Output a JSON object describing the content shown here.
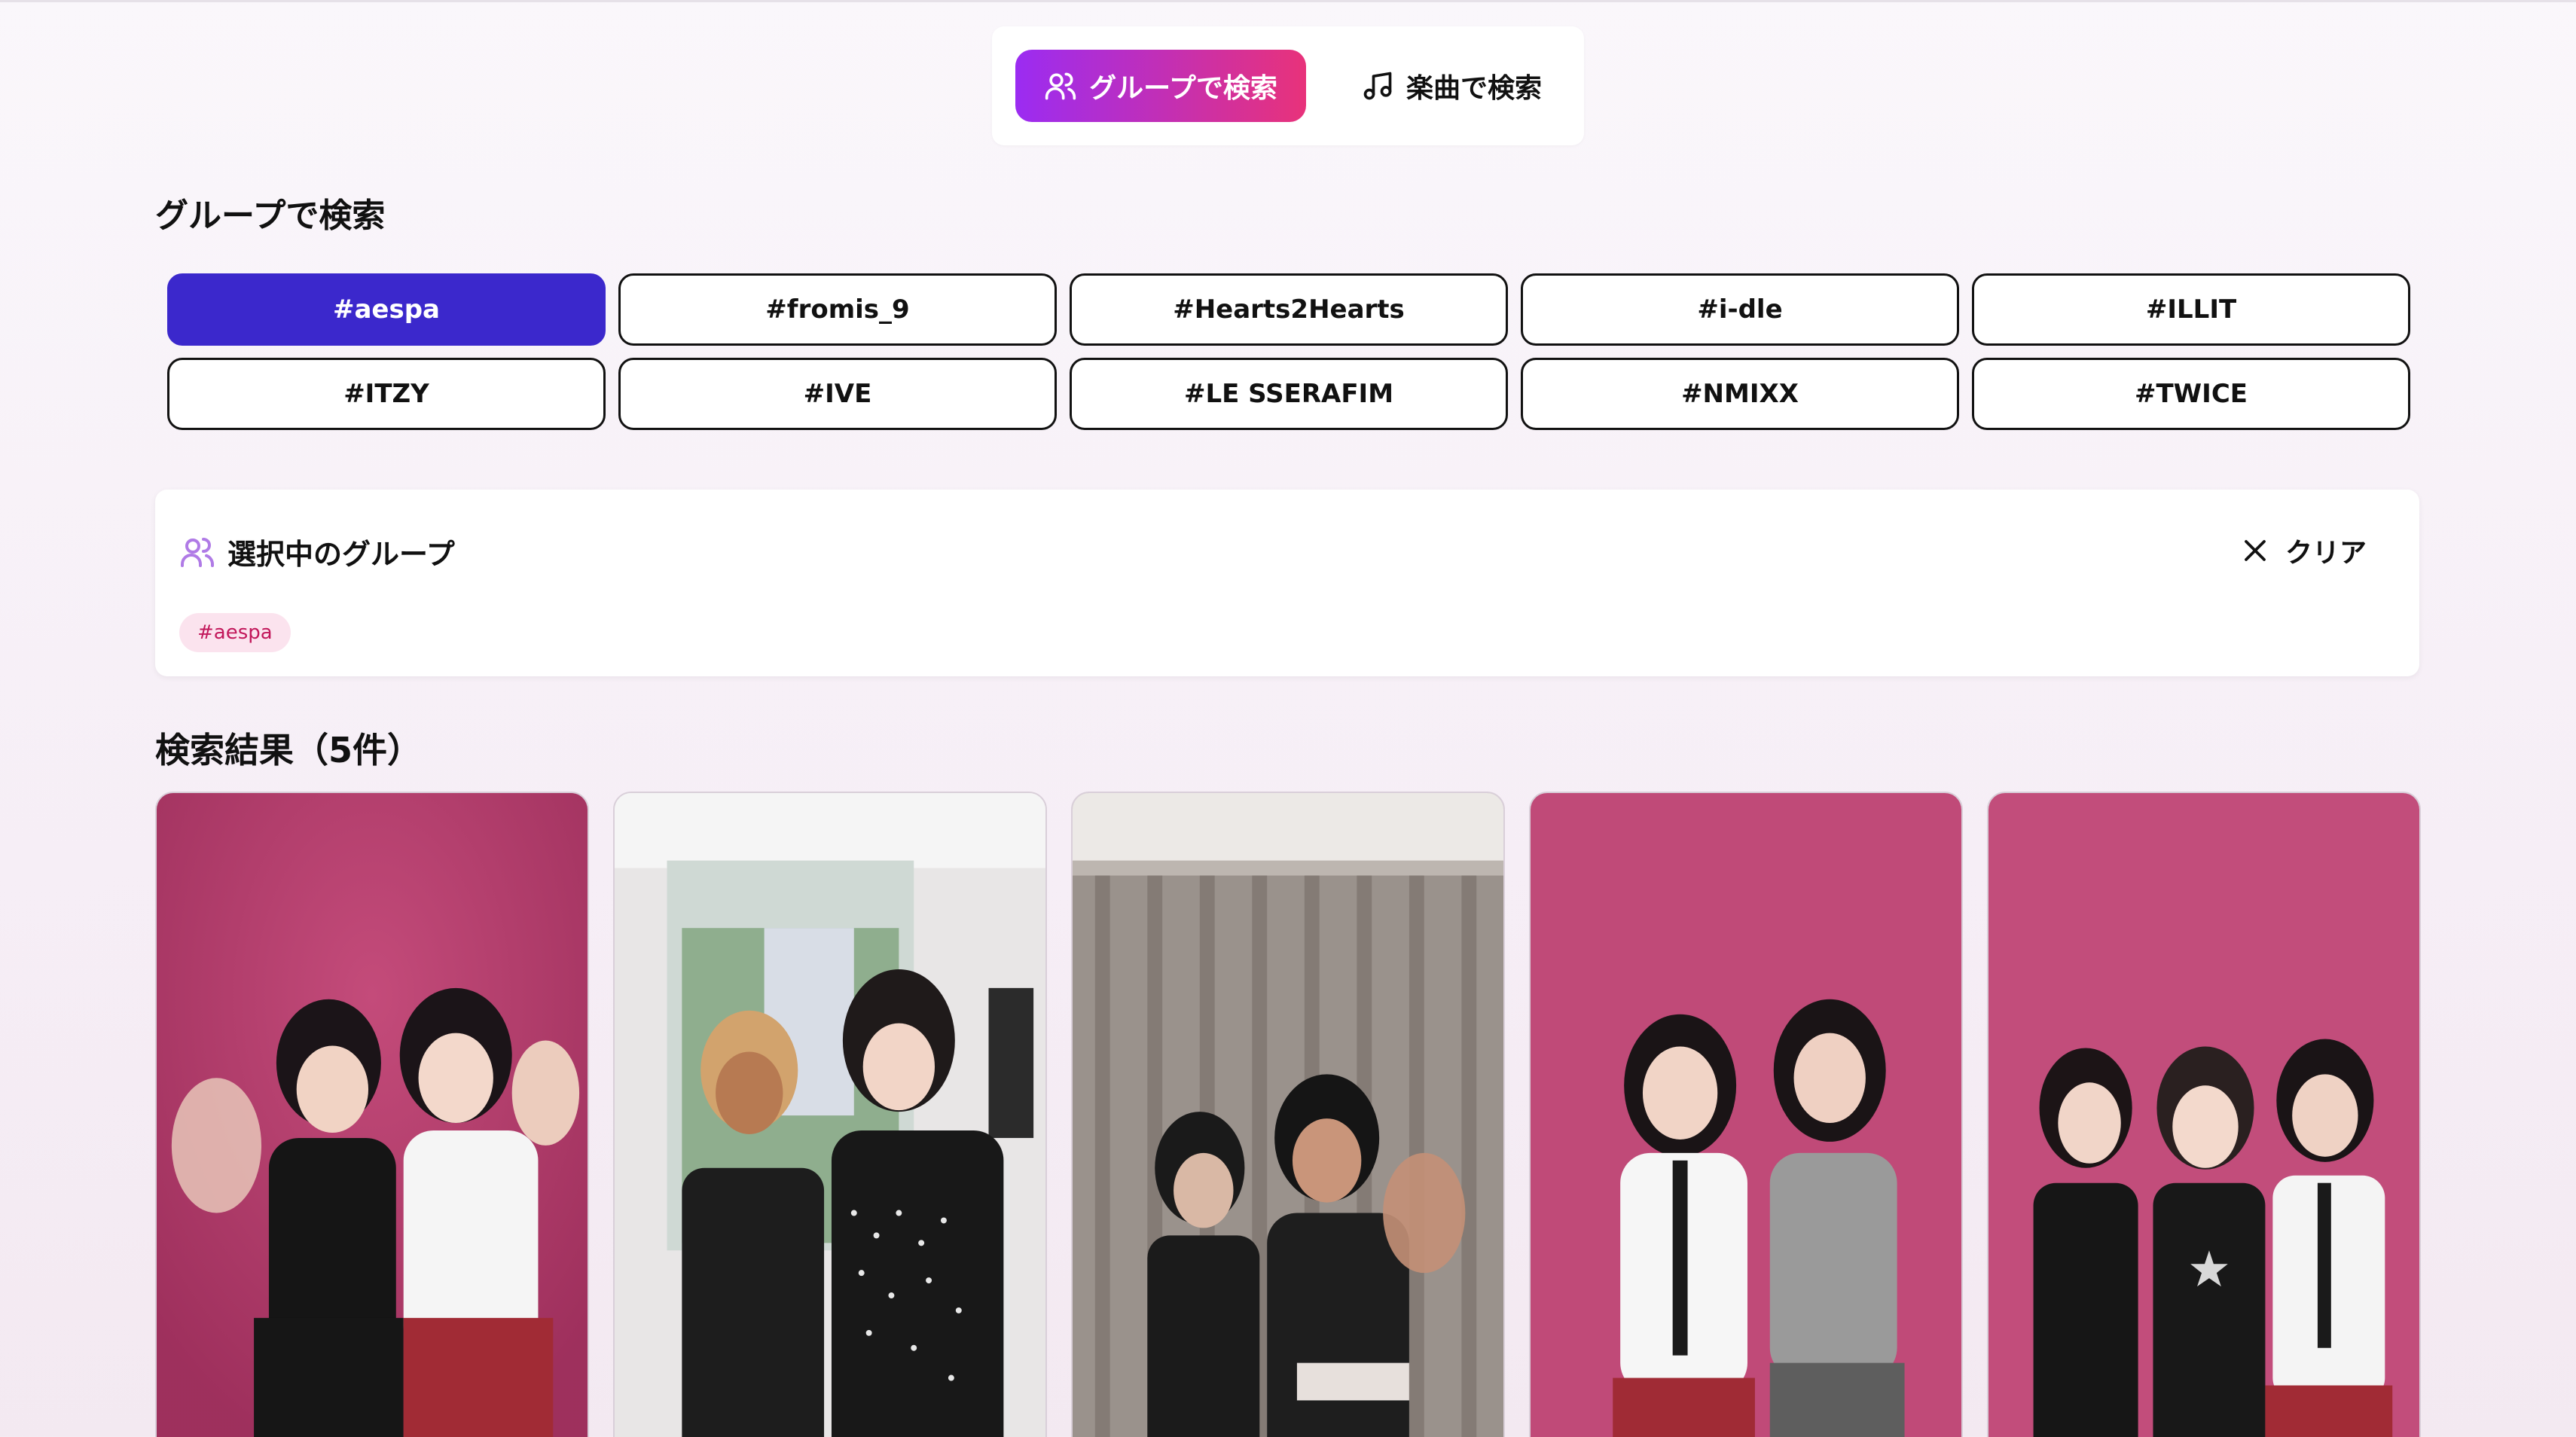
{
  "mode_switch": {
    "group_label": "グループで検索",
    "song_label": "楽曲で検索",
    "active": "group"
  },
  "section_title": "グループで検索",
  "tags": [
    "#aespa",
    "#fromis_9",
    "#Hearts2Hearts",
    "#i-dle",
    "#ILLIT",
    "#ITZY",
    "#IVE",
    "#LE SSERAFIM",
    "#NMIXX",
    "#TWICE"
  ],
  "selected_tag": "#aespa",
  "selected_panel": {
    "title": "選択中のグループ",
    "clear_label": "クリア",
    "chips": [
      "#aespa"
    ]
  },
  "results": {
    "title": "検索結果（5件）",
    "cards": [
      {
        "background": "pink-wall",
        "people": 2
      },
      {
        "background": "room-window",
        "people": 2
      },
      {
        "background": "curtain-room",
        "people": 2
      },
      {
        "background": "pink-wall",
        "people": 2
      },
      {
        "background": "pink-wall",
        "people": 3
      }
    ]
  },
  "colors": {
    "accent_purple": "#9b2cf2",
    "accent_pink": "#e8327a",
    "selected_tag": "#3b28cc",
    "chip_bg": "#fbe3ee",
    "chip_text": "#c2185b"
  }
}
